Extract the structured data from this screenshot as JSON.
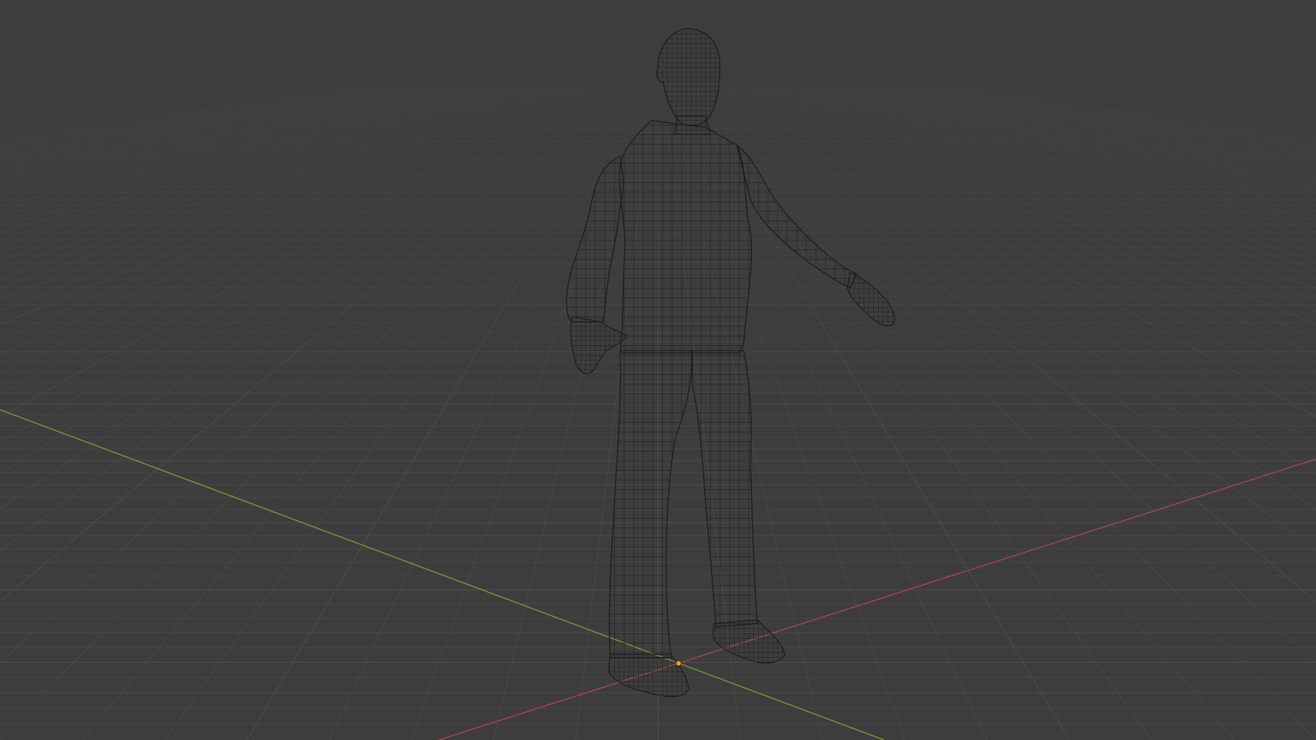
{
  "app": {
    "view": "3D Viewport",
    "shading": "wireframe",
    "object": "character-mesh"
  },
  "colors": {
    "background": "#3d3d3d",
    "grid_line": "#4a4a4a",
    "grid_line_major": "#505050",
    "x_axis": "#b0454f",
    "y_axis": "#7a9a3a",
    "wire": "#1e1e1e",
    "mesh_fill": "#3a3a3a",
    "origin": "#e8a020"
  }
}
